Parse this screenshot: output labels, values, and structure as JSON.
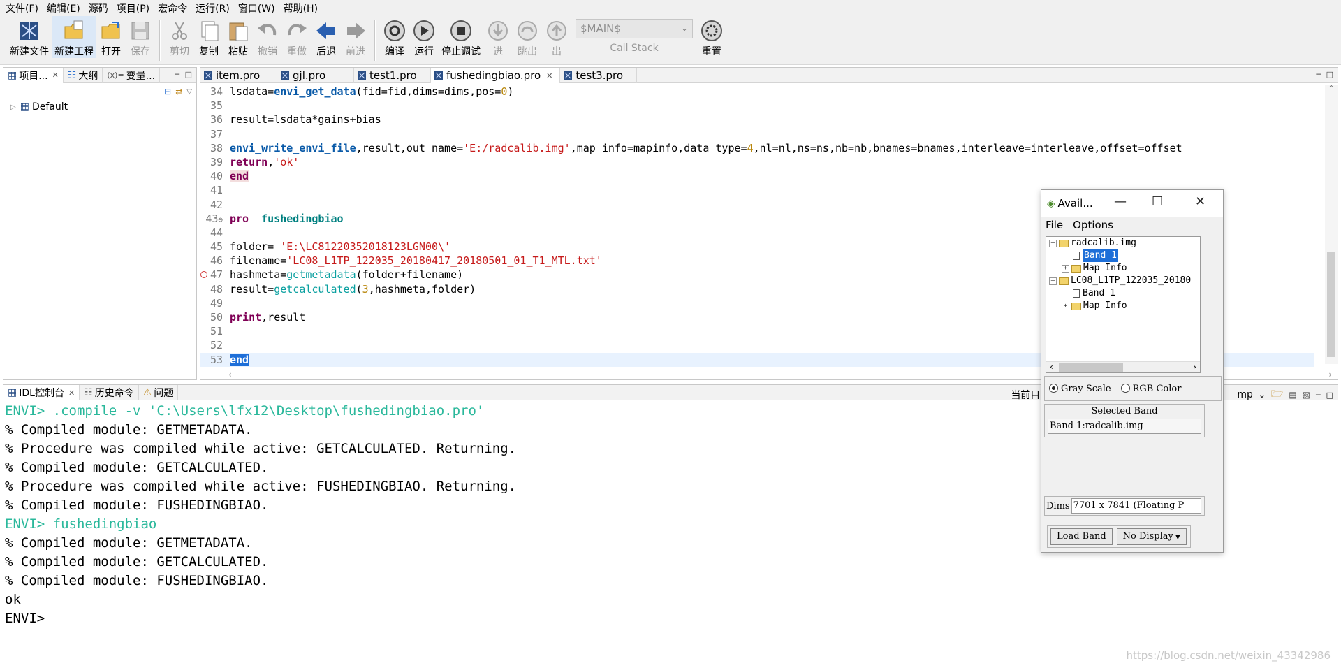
{
  "menu": [
    "文件(F)",
    "编辑(E)",
    "源码",
    "项目(P)",
    "宏命令",
    "运行(R)",
    "窗口(W)",
    "帮助(H)"
  ],
  "toolbar": {
    "new_file": "新建文件",
    "new_project": "新建工程",
    "open": "打开",
    "save": "保存",
    "cut": "剪切",
    "copy": "复制",
    "paste": "粘贴",
    "undo": "撤销",
    "redo": "重做",
    "back": "后退",
    "forward": "前进",
    "compile": "编译",
    "run": "运行",
    "stop": "停止调试",
    "step_in": "进",
    "step_over": "跳出",
    "step_out": "出",
    "stack_value": "$MAIN$",
    "call_stack": "Call Stack",
    "reset": "重置"
  },
  "left_panel": {
    "tabs": [
      "项目...",
      "大纲",
      "变量..."
    ],
    "tree_root": "Default"
  },
  "editor": {
    "tabs": [
      "item.pro",
      "gjl.pro",
      "test1.pro",
      "fushedingbiao.pro",
      "test3.pro"
    ],
    "active_tab": "fushedingbiao.pro"
  },
  "console": {
    "tabs": [
      "IDL控制台",
      "历史命令",
      "问题"
    ],
    "current_dir_label": "当前目录",
    "dir_tail": "mp",
    "lines": [
      "ENVI> .compile -v 'C:\\Users\\lfx12\\Desktop\\fushedingbiao.pro'",
      "% Compiled module: GETMETADATA.",
      "% Procedure was compiled while active: GETCALCULATED. Returning.",
      "% Compiled module: GETCALCULATED.",
      "% Procedure was compiled while active: FUSHEDINGBIAO. Returning.",
      "% Compiled module: FUSHEDINGBIAO.",
      "ENVI> fushedingbiao",
      "% Compiled module: GETMETADATA.",
      "% Compiled module: GETCALCULATED.",
      "% Compiled module: FUSHEDINGBIAO.",
      "ok",
      "ENVI>"
    ]
  },
  "watermark": "https://blog.csdn.net/weixin_43342986",
  "avail_dialog": {
    "title": "Avail...",
    "menu": [
      "File",
      "Options"
    ],
    "tree": {
      "file1": "radcalib.img",
      "file1_band": "Band 1",
      "file1_map": "Map Info",
      "file2": "LC08_L1TP_122035_20180",
      "file2_band": "Band 1",
      "file2_map": "Map Info"
    },
    "gray_scale": "Gray Scale",
    "rgb_color": "RGB Color",
    "selected_band_label": "Selected Band",
    "selected_band_value": "Band 1:radcalib.img",
    "dims_label": "Dims",
    "dims_value": "7701 x 7841 (Floating P",
    "load_band": "Load Band",
    "no_display": "No Display"
  },
  "colors": {
    "keyword": "#7f0055",
    "function": "#0a5aa8",
    "string": "#c61a1a",
    "number": "#b8860b",
    "console_prompt": "#2ab89b",
    "selection": "#1e6fd8"
  }
}
